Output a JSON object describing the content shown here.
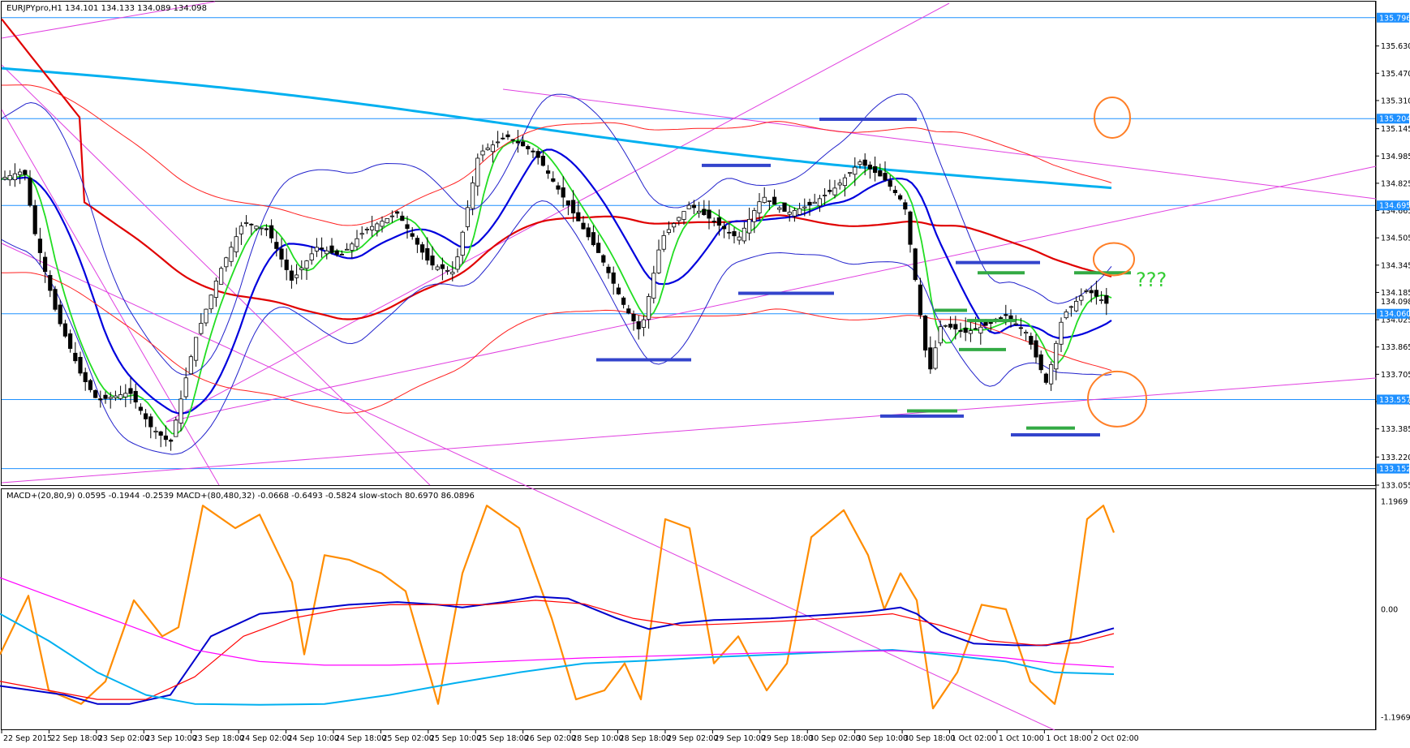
{
  "chart_data": [
    {
      "type": "candlestick",
      "title": "EURJPYpro,H1 134.101 134.133 134.089 134.098",
      "symbol": "EURJPYpro,H1",
      "ohlc_header": {
        "open": "134.101",
        "high": "134.133",
        "low": "134.089",
        "close": "134.098"
      },
      "ylim": [
        133.055,
        135.89
      ],
      "y_ticks": [
        "135.630",
        "135.470",
        "135.310",
        "135.145",
        "134.985",
        "134.825",
        "134.665",
        "134.505",
        "134.345",
        "134.185",
        "134.025",
        "133.865",
        "133.705",
        "133.545",
        "133.385",
        "133.220",
        "133.055"
      ],
      "horizontal_levels": [
        {
          "value": 135.796,
          "label": "135.796"
        },
        {
          "value": 135.204,
          "label": "135.204"
        },
        {
          "value": 134.695,
          "label": "134.695"
        },
        {
          "value": 134.06,
          "label": "134.060"
        },
        {
          "value": 133.557,
          "label": "133.557"
        },
        {
          "value": 133.152,
          "label": "133.152"
        }
      ],
      "current_price": {
        "value": 134.098,
        "label": "134.098"
      },
      "annotation_text": "???",
      "x_ticks": [
        "22 Sep 2015",
        "22 Sep 18:00",
        "23 Sep 02:00",
        "23 Sep 10:00",
        "23 Sep 18:00",
        "24 Sep 02:00",
        "24 Sep 10:00",
        "24 Sep 18:00",
        "25 Sep 02:00",
        "25 Sep 10:00",
        "25 Sep 18:00",
        "26 Sep 02:00",
        "28 Sep 10:00",
        "28 Sep 18:00",
        "29 Sep 02:00",
        "29 Sep 10:00",
        "29 Sep 18:00",
        "30 Sep 02:00",
        "30 Sep 10:00",
        "30 Sep 18:00",
        "1 Oct 02:00",
        "1 Oct 10:00",
        "1 Oct 18:00",
        "2 Oct 02:00"
      ],
      "price_path": [
        [
          0,
          134.85
        ],
        [
          30,
          134.9
        ],
        [
          42,
          134.55
        ],
        [
          70,
          134.05
        ],
        [
          100,
          133.7
        ],
        [
          120,
          133.55
        ],
        [
          160,
          133.6
        ],
        [
          185,
          133.4
        ],
        [
          210,
          133.3
        ],
        [
          240,
          133.9
        ],
        [
          270,
          134.3
        ],
        [
          300,
          134.6
        ],
        [
          330,
          134.55
        ],
        [
          360,
          134.25
        ],
        [
          390,
          134.45
        ],
        [
          420,
          134.4
        ],
        [
          450,
          134.55
        ],
        [
          490,
          134.65
        ],
        [
          530,
          134.35
        ],
        [
          560,
          134.3
        ],
        [
          590,
          135.0
        ],
        [
          625,
          135.1
        ],
        [
          660,
          135.0
        ],
        [
          700,
          134.7
        ],
        [
          740,
          134.4
        ],
        [
          770,
          134.1
        ],
        [
          790,
          133.95
        ],
        [
          815,
          134.5
        ],
        [
          850,
          134.7
        ],
        [
          880,
          134.6
        ],
        [
          910,
          134.5
        ],
        [
          940,
          134.75
        ],
        [
          970,
          134.65
        ],
        [
          1000,
          134.7
        ],
        [
          1030,
          134.8
        ],
        [
          1060,
          134.95
        ],
        [
          1090,
          134.85
        ],
        [
          1115,
          134.7
        ],
        [
          1130,
          134.2
        ],
        [
          1145,
          133.7
        ],
        [
          1160,
          134.0
        ],
        [
          1190,
          133.95
        ],
        [
          1220,
          134.0
        ],
        [
          1240,
          134.05
        ],
        [
          1265,
          133.95
        ],
        [
          1290,
          133.65
        ],
        [
          1310,
          134.05
        ],
        [
          1340,
          134.2
        ],
        [
          1370,
          134.1
        ]
      ]
    },
    {
      "type": "line",
      "title": "MACD+(20,80,9) 0.0595 -0.1944 -0.2539 MACD+(80,480,32) -0.0668 -0.6493 -0.5824 slow-stoch 80.6970 86.0896",
      "ylim": [
        -1.1969,
        1.1969
      ],
      "y_ticks": [
        "1.1969",
        "0.00",
        "-1.1969"
      ],
      "series": [
        {
          "name": "slow-stoch",
          "color": "#ff8c00",
          "values": [
            [
              0,
              -0.5
            ],
            [
              35,
              0.15
            ],
            [
              60,
              -0.9
            ],
            [
              100,
              -1.05
            ],
            [
              130,
              -0.8
            ],
            [
              165,
              0.1
            ],
            [
              200,
              -0.3
            ],
            [
              220,
              -0.2
            ],
            [
              250,
              1.15
            ],
            [
              290,
              0.9
            ],
            [
              320,
              1.05
            ],
            [
              360,
              0.3
            ],
            [
              375,
              -0.5
            ],
            [
              400,
              0.6
            ],
            [
              430,
              0.55
            ],
            [
              470,
              0.4
            ],
            [
              500,
              0.2
            ],
            [
              540,
              -1.05
            ],
            [
              570,
              0.4
            ],
            [
              600,
              1.15
            ],
            [
              640,
              0.9
            ],
            [
              680,
              -0.1
            ],
            [
              710,
              -1.0
            ],
            [
              745,
              -0.9
            ],
            [
              770,
              -0.6
            ],
            [
              790,
              -1.0
            ],
            [
              820,
              1.0
            ],
            [
              850,
              0.9
            ],
            [
              880,
              -0.6
            ],
            [
              910,
              -0.3
            ],
            [
              945,
              -0.9
            ],
            [
              970,
              -0.6
            ],
            [
              1000,
              0.8
            ],
            [
              1040,
              1.1
            ],
            [
              1070,
              0.6
            ],
            [
              1090,
              0.0
            ],
            [
              1110,
              0.4
            ],
            [
              1130,
              0.1
            ],
            [
              1150,
              -1.1
            ],
            [
              1180,
              -0.7
            ],
            [
              1210,
              0.05
            ],
            [
              1240,
              0.0
            ],
            [
              1270,
              -0.8
            ],
            [
              1300,
              -1.05
            ],
            [
              1320,
              -0.3
            ],
            [
              1340,
              1.0
            ],
            [
              1360,
              1.15
            ],
            [
              1373,
              0.85
            ]
          ]
        },
        {
          "name": "MACD+(20,80,9)",
          "color": "#0000cc",
          "values": [
            [
              0,
              -0.85
            ],
            [
              40,
              -0.9
            ],
            [
              80,
              -0.95
            ],
            [
              120,
              -1.05
            ],
            [
              160,
              -1.05
            ],
            [
              210,
              -0.95
            ],
            [
              260,
              -0.3
            ],
            [
              320,
              -0.05
            ],
            [
              380,
              0.0
            ],
            [
              430,
              0.05
            ],
            [
              490,
              0.08
            ],
            [
              540,
              0.05
            ],
            [
              570,
              0.02
            ],
            [
              620,
              0.08
            ],
            [
              660,
              0.14
            ],
            [
              700,
              0.12
            ],
            [
              760,
              -0.1
            ],
            [
              800,
              -0.22
            ],
            [
              840,
              -0.15
            ],
            [
              880,
              -0.12
            ],
            [
              950,
              -0.1
            ],
            [
              1020,
              -0.06
            ],
            [
              1070,
              -0.03
            ],
            [
              1110,
              0.02
            ],
            [
              1130,
              -0.05
            ],
            [
              1160,
              -0.25
            ],
            [
              1200,
              -0.38
            ],
            [
              1250,
              -0.4
            ],
            [
              1290,
              -0.4
            ],
            [
              1330,
              -0.32
            ],
            [
              1373,
              -0.21
            ]
          ]
        },
        {
          "name": "MACD+(20,80,9) signal",
          "color": "#ff0000",
          "values": [
            [
              0,
              -0.8
            ],
            [
              60,
              -0.9
            ],
            [
              120,
              -1.0
            ],
            [
              180,
              -1.0
            ],
            [
              240,
              -0.75
            ],
            [
              300,
              -0.3
            ],
            [
              360,
              -0.1
            ],
            [
              420,
              0.0
            ],
            [
              480,
              0.05
            ],
            [
              540,
              0.05
            ],
            [
              600,
              0.05
            ],
            [
              660,
              0.1
            ],
            [
              720,
              0.06
            ],
            [
              780,
              -0.1
            ],
            [
              840,
              -0.18
            ],
            [
              900,
              -0.16
            ],
            [
              970,
              -0.13
            ],
            [
              1040,
              -0.09
            ],
            [
              1100,
              -0.05
            ],
            [
              1160,
              -0.18
            ],
            [
              1220,
              -0.35
            ],
            [
              1280,
              -0.4
            ],
            [
              1330,
              -0.37
            ],
            [
              1373,
              -0.27
            ]
          ]
        },
        {
          "name": "MACD+(80,480,32)",
          "color": "#00b0f0",
          "values": [
            [
              0,
              -0.05
            ],
            [
              60,
              -0.35
            ],
            [
              120,
              -0.7
            ],
            [
              180,
              -0.95
            ],
            [
              240,
              -1.05
            ],
            [
              320,
              -1.06
            ],
            [
              400,
              -1.05
            ],
            [
              480,
              -0.95
            ],
            [
              560,
              -0.82
            ],
            [
              640,
              -0.7
            ],
            [
              720,
              -0.6
            ],
            [
              800,
              -0.57
            ],
            [
              880,
              -0.53
            ],
            [
              960,
              -0.5
            ],
            [
              1040,
              -0.47
            ],
            [
              1100,
              -0.45
            ],
            [
              1160,
              -0.5
            ],
            [
              1240,
              -0.58
            ],
            [
              1300,
              -0.7
            ],
            [
              1373,
              -0.72
            ]
          ]
        },
        {
          "name": "MACD+(80,480,32) signal",
          "color": "#ff00ff",
          "values": [
            [
              0,
              0.35
            ],
            [
              60,
              0.15
            ],
            [
              120,
              -0.05
            ],
            [
              180,
              -0.25
            ],
            [
              240,
              -0.45
            ],
            [
              320,
              -0.58
            ],
            [
              400,
              -0.62
            ],
            [
              480,
              -0.62
            ],
            [
              560,
              -0.6
            ],
            [
              640,
              -0.57
            ],
            [
              720,
              -0.54
            ],
            [
              800,
              -0.52
            ],
            [
              880,
              -0.5
            ],
            [
              960,
              -0.48
            ],
            [
              1040,
              -0.47
            ],
            [
              1100,
              -0.46
            ],
            [
              1160,
              -0.48
            ],
            [
              1240,
              -0.54
            ],
            [
              1300,
              -0.6
            ],
            [
              1373,
              -0.64
            ]
          ]
        }
      ]
    }
  ]
}
